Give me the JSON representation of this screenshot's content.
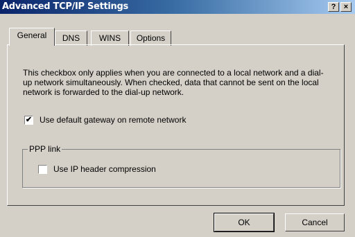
{
  "window": {
    "title": "Advanced TCP/IP Settings",
    "help_button": "?",
    "close_button": "×"
  },
  "tabs": [
    "General",
    "DNS",
    "WINS",
    "Options"
  ],
  "active_tab": "General",
  "general": {
    "description": "This checkbox only applies when you are connected to a local network and a dial-up network simultaneously.  When checked, data that cannot be sent on the local network is forwarded to the dial-up network.",
    "default_gateway": {
      "label": "Use default gateway on remote network",
      "checked": true,
      "mark": "✔"
    },
    "ppp_group": {
      "label": "PPP link",
      "ip_header_compression": {
        "label": "Use IP header compression",
        "checked": false
      }
    }
  },
  "buttons": {
    "ok": "OK",
    "cancel": "Cancel"
  }
}
